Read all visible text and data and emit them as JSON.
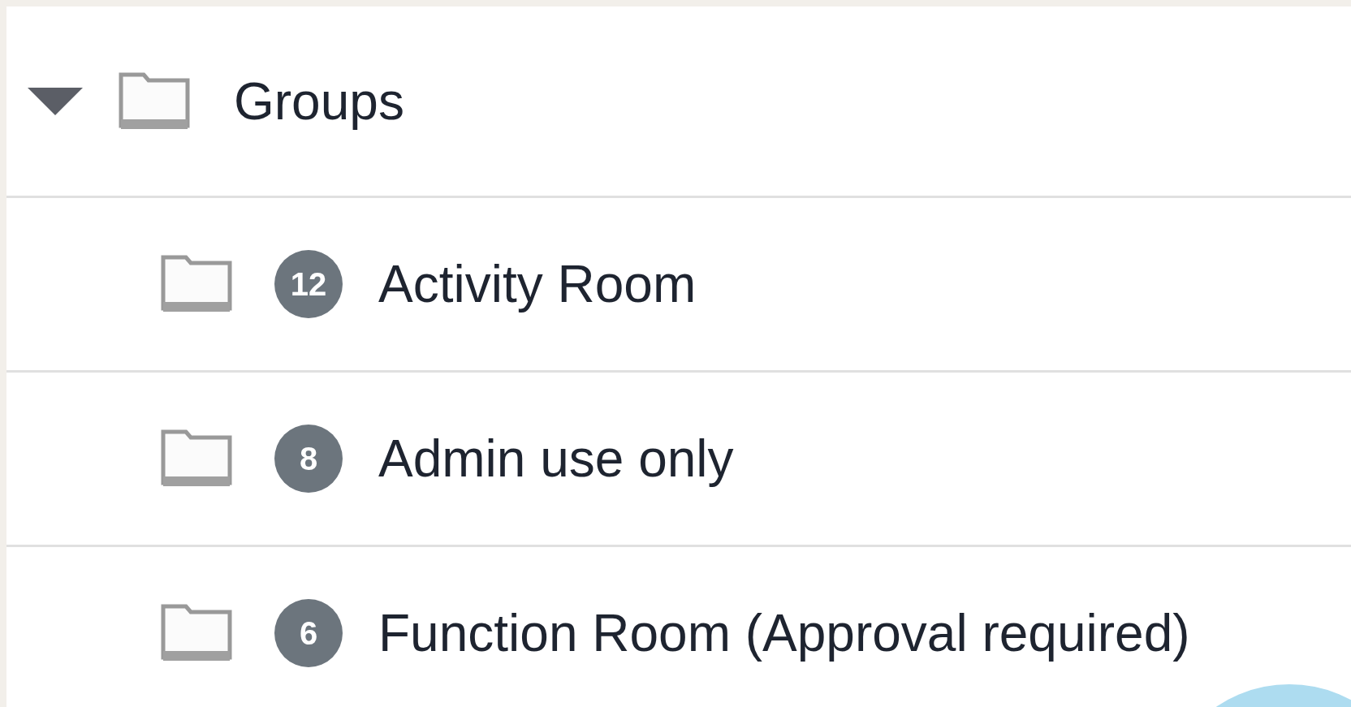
{
  "tree": [
    {
      "label": "Groups",
      "expanded": true,
      "children": [
        {
          "label": "Activity Room",
          "count": "12"
        },
        {
          "label": "Admin use only",
          "count": "8"
        },
        {
          "label": "Function Room (Approval required)",
          "count": "6"
        }
      ]
    }
  ]
}
